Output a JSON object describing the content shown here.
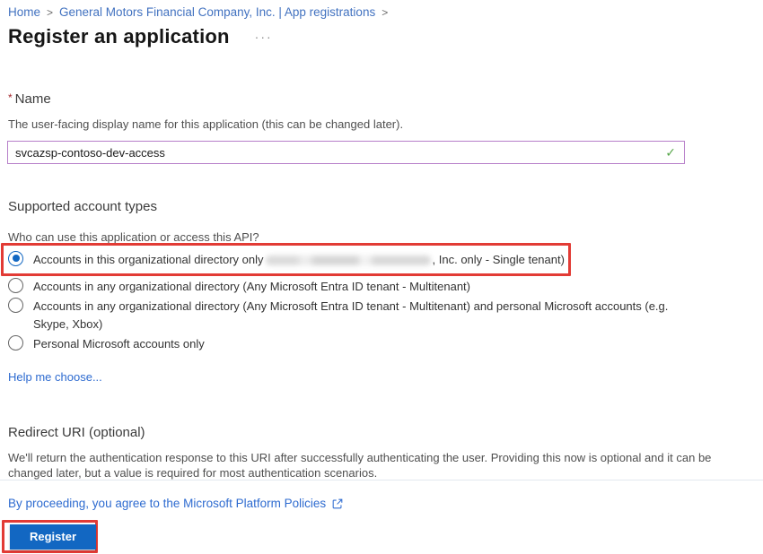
{
  "breadcrumb": {
    "separator": ">",
    "items": [
      {
        "label": "Home"
      },
      {
        "label": "General Motors Financial Company, Inc. | App registrations"
      }
    ]
  },
  "header": {
    "title": "Register an application",
    "ellipsis": "···"
  },
  "name_section": {
    "required_marker": "*",
    "label": "Name",
    "hint": "The user-facing display name for this application (this can be changed later).",
    "input_value": "svcazsp-contoso-dev-access",
    "valid_icon": "✓"
  },
  "account_types": {
    "heading": "Supported account types",
    "question": "Who can use this application or access this API?",
    "options": [
      {
        "label_start": "Accounts in this organizational directory only",
        "redacted": true,
        "label_end": ", Inc. only - Single tenant)",
        "selected": true,
        "highlighted": true
      },
      {
        "label": "Accounts in any organizational directory (Any Microsoft Entra ID tenant - Multitenant)",
        "selected": false
      },
      {
        "label": "Accounts in any organizational directory (Any Microsoft Entra ID tenant - Multitenant) and personal Microsoft accounts (e.g. Skype, Xbox)",
        "selected": false
      },
      {
        "label": "Personal Microsoft accounts only",
        "selected": false
      }
    ],
    "help_link": "Help me choose..."
  },
  "redirect_section": {
    "heading": "Redirect URI (optional)",
    "description": "We'll return the authentication response to this URI after successfully authenticating the user. Providing this now is optional and it can be changed later, but a value is required for most authentication scenarios."
  },
  "footer": {
    "policy_text": "By proceeding, you agree to the Microsoft Platform Policies",
    "register_label": "Register"
  },
  "colors": {
    "link_blue": "#2e6bd0",
    "breadcrumb_blue": "#4272c0",
    "button_blue": "#1267c2",
    "annotation_red": "#e23b35",
    "input_border_purple": "#b77fc9",
    "valid_green": "#57a64a",
    "required_red": "#a4262c"
  }
}
